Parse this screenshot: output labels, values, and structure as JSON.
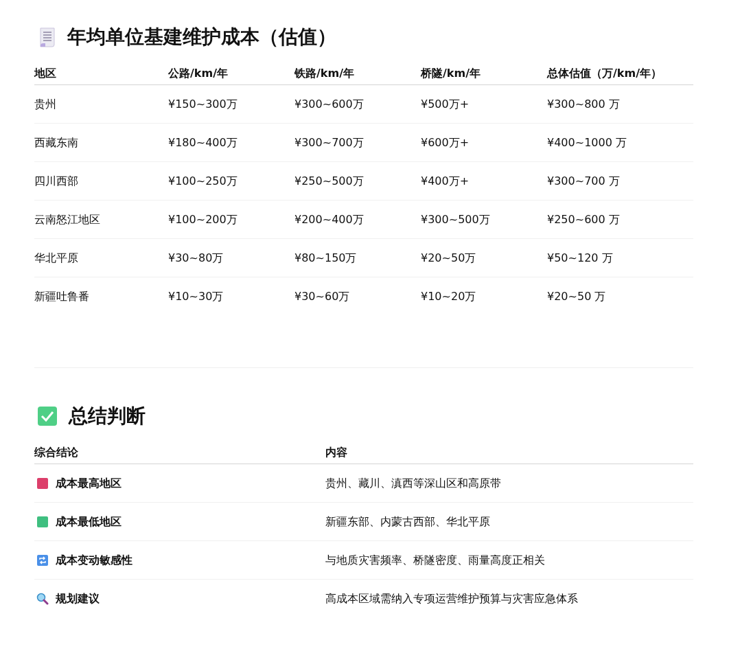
{
  "cost_section": {
    "title": "年均单位基建维护成本（估值）",
    "columns": [
      "地区",
      "公路/km/年",
      "铁路/km/年",
      "桥隧/km/年",
      "总体估值（万/km/年）"
    ],
    "rows": [
      [
        "贵州",
        "¥150~300万",
        "¥300~600万",
        "¥500万+",
        "¥300~800 万"
      ],
      [
        "西藏东南",
        "¥180~400万",
        "¥300~700万",
        "¥600万+",
        "¥400~1000 万"
      ],
      [
        "四川西部",
        "¥100~250万",
        "¥250~500万",
        "¥400万+",
        "¥300~700 万"
      ],
      [
        "云南怒江地区",
        "¥100~200万",
        "¥200~400万",
        "¥300~500万",
        "¥250~600 万"
      ],
      [
        "华北平原",
        "¥30~80万",
        "¥80~150万",
        "¥20~50万",
        "¥50~120 万"
      ],
      [
        "新疆吐鲁番",
        "¥10~30万",
        "¥30~60万",
        "¥10~20万",
        "¥20~50 万"
      ]
    ]
  },
  "summary_section": {
    "title": "总结判断",
    "columns": [
      "综合结论",
      "内容"
    ],
    "rows": [
      {
        "kind": "red-square",
        "label": "成本最高地区",
        "content": "贵州、藏川、滇西等深山区和高原带"
      },
      {
        "kind": "green-square",
        "label": "成本最低地区",
        "content": "新疆东部、内蒙古西部、华北平原"
      },
      {
        "kind": "repeat",
        "label": "成本变动敏感性",
        "content": "与地质灾害频率、桥隧密度、雨量高度正相关"
      },
      {
        "kind": "magnifier",
        "label": "规划建议",
        "content": "高成本区域需纳入专项运营维护预算与灾害应急体系"
      }
    ]
  }
}
